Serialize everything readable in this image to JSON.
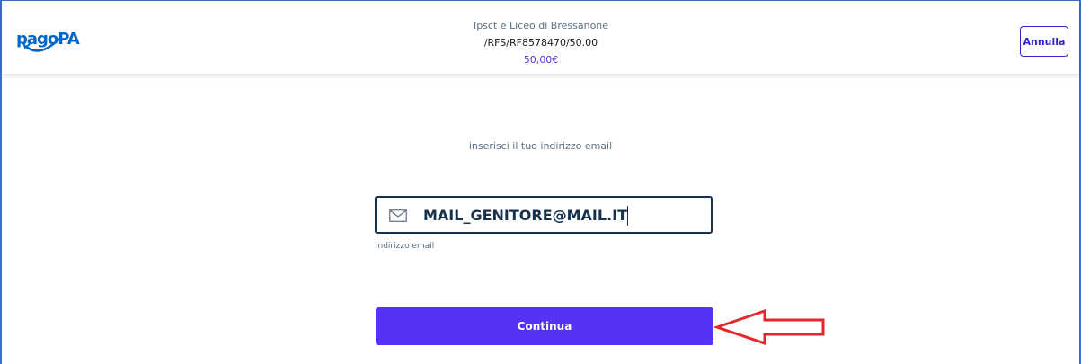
{
  "header": {
    "logo_text": "pagoPA",
    "creditor": "Ipsct e Liceo di Bressanone",
    "notice_code": "/RFS/RF8578470/50.00",
    "amount": "50,00€",
    "cancel_label": "Annulla"
  },
  "main": {
    "prompt": "inserisci il tuo indirizzo email",
    "email_value": "MAIL_GENITORE@MAIL.IT",
    "email_helper": "indirizzo email",
    "continue_label": "Continua",
    "email_icon": "mail-icon"
  },
  "annotation": {
    "arrow_color": "#e3262a",
    "arrow_icon": "left-arrow-icon"
  },
  "colors": {
    "primary": "#5532f5",
    "brand_blue": "#0066cc",
    "amount": "#5b2ee6"
  }
}
